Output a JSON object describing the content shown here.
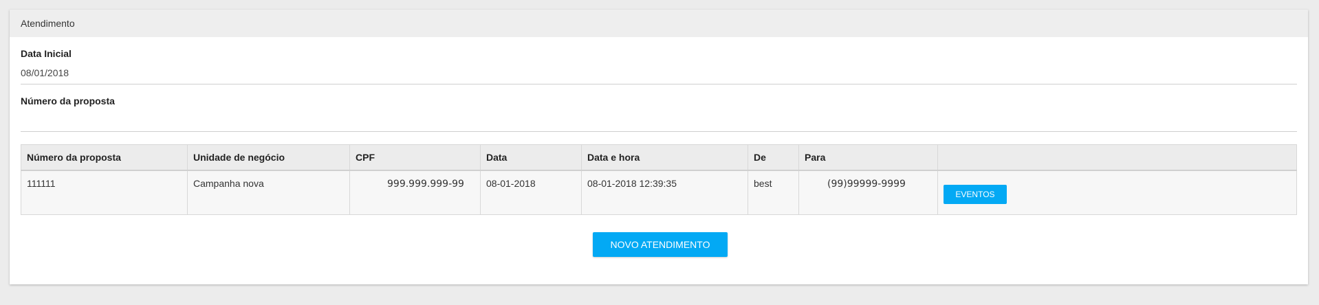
{
  "panel": {
    "title": "Atendimento"
  },
  "form": {
    "data_inicial": {
      "label": "Data Inicial",
      "value": "08/01/2018"
    },
    "numero_proposta": {
      "label": "Número da proposta",
      "value": ""
    }
  },
  "table": {
    "columns": [
      "Número da proposta",
      "Unidade de negócio",
      "CPF",
      "Data",
      "Data e hora",
      "De",
      "Para",
      ""
    ],
    "rows": [
      {
        "numero_proposta": "111111",
        "unidade_negocio": "Campanha nova",
        "cpf": "999.999.999-99",
        "data": "08-01-2018",
        "data_hora": "08-01-2018 12:39:35",
        "de": "best",
        "para": "(99)99999-9999",
        "action_label": "EVENTOS"
      }
    ]
  },
  "actions": {
    "novo_atendimento_label": "NOVO ATENDIMENTO"
  },
  "colors": {
    "accent": "#03a9f4",
    "header_bg": "#eeeeee",
    "page_bg": "#ececec"
  }
}
